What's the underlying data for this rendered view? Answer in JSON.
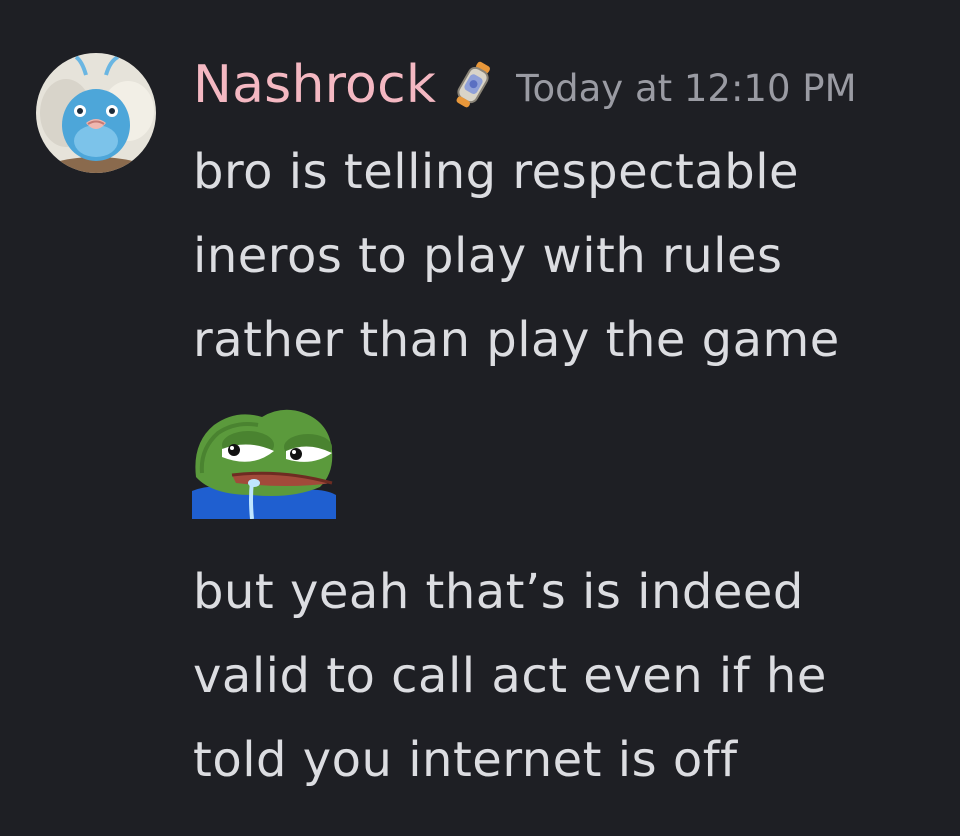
{
  "message": {
    "author": "Nashrock",
    "badge_icon": "potion-badge-icon",
    "timestamp": "Today at 12:10 PM",
    "text_part_1": {
      "lines": [
        "bro is telling respectable",
        "ineros to play with rules",
        "rather than play the game"
      ]
    },
    "emoji_icon": "pepe-drooling-emoji",
    "text_part_2": {
      "lines": [
        "but yeah that’s is indeed",
        "valid to call act even if he",
        "told you internet is off"
      ]
    }
  },
  "colors": {
    "background": "#1e1f24",
    "username": "#f4b8c2",
    "timestamp": "#9a9ba3",
    "message_text": "#dcdde1"
  }
}
